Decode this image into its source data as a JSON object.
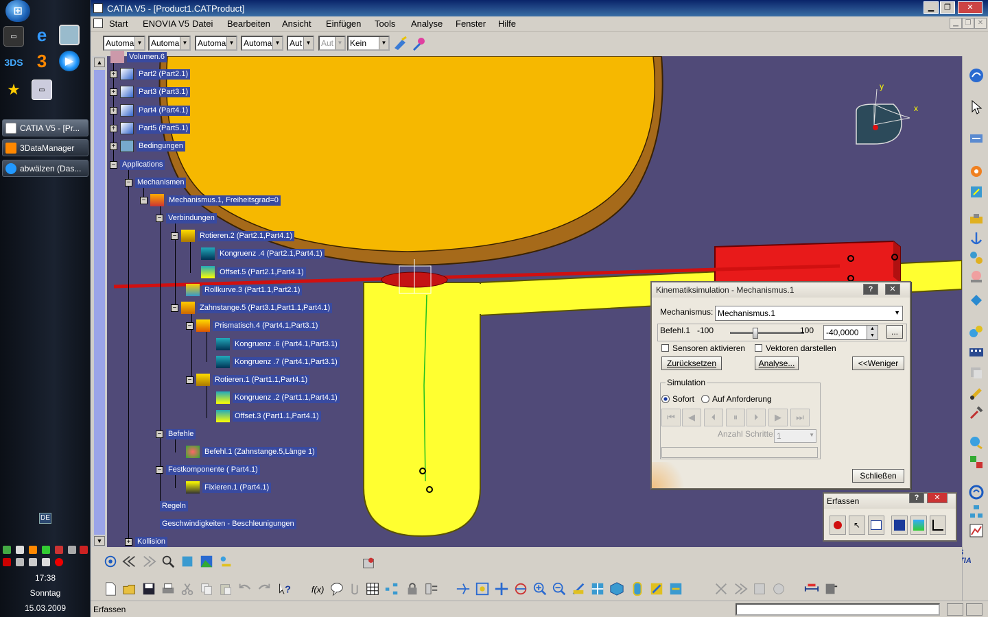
{
  "taskbar": {
    "tasks": [
      "CATIA V5 - [Pr...",
      "3DataManager",
      "abwälzen (Das..."
    ],
    "language": "DE",
    "clock_time": "17:38",
    "clock_day": "Sonntag",
    "clock_date": "15.03.2009"
  },
  "window": {
    "title": "CATIA V5 - [Product1.CATProduct]",
    "minimize": "▁",
    "restore": "❐",
    "close": "✕"
  },
  "menu": {
    "items": [
      "Start",
      "ENOVIA V5",
      "Datei",
      "Bearbeiten",
      "Ansicht",
      "Einfügen",
      "Tools",
      "Analyse",
      "Fenster",
      "Hilfe"
    ]
  },
  "properties": {
    "combos": [
      "Automa",
      "Automa",
      "Automa",
      "Automa",
      "Aut",
      "Aut",
      "Kein"
    ]
  },
  "tree": {
    "nodes": [
      "Volumen.6",
      "Part2 (Part2.1)",
      "Part3 (Part3.1)",
      "Part4 (Part4.1)",
      "Part5 (Part5.1)",
      "Bedingungen",
      "Applications",
      "Mechanismen",
      "Mechanismus.1, Freiheitsgrad=0",
      "Verbindungen",
      "Rotieren.2 (Part2.1,Part4.1)",
      "Kongruenz .4 (Part2.1,Part4.1)",
      "Offset.5 (Part2.1,Part4.1)",
      "Rollkurve.3 (Part1.1,Part2.1)",
      "Zahnstange.5 (Part3.1,Part1.1,Part4.1)",
      "Prismatisch.4 (Part4.1,Part3.1)",
      "Kongruenz .6 (Part4.1,Part3.1)",
      "Kongruenz .7 (Part4.1,Part3.1)",
      "Rotieren.1 (Part1.1,Part4.1)",
      "Kongruenz .2 (Part1.1,Part4.1)",
      "Offset.3 (Part1.1,Part4.1)",
      "Befehle",
      "Befehl.1 (Zahnstange.5,Länge 1)",
      "Festkomponente ( Part4.1)",
      "Fixieren.1 (Part4.1)",
      "Regeln",
      "Geschwindigkeiten - Beschleunigungen",
      "Kollision"
    ]
  },
  "compass": {
    "x_label": "x",
    "y_label": "y"
  },
  "kinematics_dialog": {
    "title": "Kinematiksimulation - Mechanismus.1",
    "help": "?",
    "close": "✕",
    "mechanism_label": "Mechanismus:",
    "mechanism_value": "Mechanismus.1",
    "command_label": "Befehl.1",
    "slider_min": "-100",
    "slider_max": "100",
    "slider_value": "-40,0000",
    "slider_level": 0.3,
    "more_btn": "...",
    "sensors_label": "Sensoren aktivieren",
    "vectors_label": "Vektoren darstellen",
    "reset_btn": "Zurücksetzen",
    "analyse_btn": "Analyse...",
    "less_btn": "<<Weniger",
    "simulation_group": "Simulation",
    "immediate_label": "Sofort",
    "on_request_label": "Auf Anforderung",
    "steps_label": "Anzahl Schritte:",
    "steps_value": "1",
    "close_btn": "Schließen"
  },
  "erfassen_toolbar": {
    "title": "Erfassen",
    "help": "?",
    "close": "✕"
  },
  "status": {
    "text": "Erfassen"
  },
  "colors": {
    "viewport_bg": "#504a78",
    "tree_label_bg": "#384aa0",
    "disc_orange": "#f6b800",
    "part_yellow": "#ffff30",
    "rack_red": "#e81a1a",
    "title_blue": "#0a246a"
  }
}
